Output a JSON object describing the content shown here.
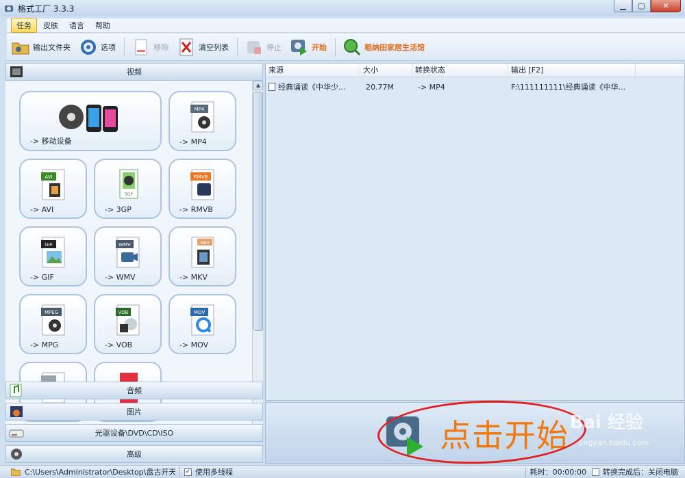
{
  "window": {
    "title": "格式工厂 3.3.3"
  },
  "menu": [
    "任务",
    "皮肤",
    "语言",
    "帮助"
  ],
  "toolbar": {
    "output_folder": "输出文件夹",
    "options": "选项",
    "remove": "移除",
    "clear_list": "清空列表",
    "stop": "停止",
    "start": "开始",
    "promo": "稻纳田家居生活馆"
  },
  "categories": {
    "video": "视频",
    "audio": "音频",
    "image": "图片",
    "disc": "光驱设备\\DVD\\CD\\ISO",
    "advanced": "高级"
  },
  "formats": [
    {
      "label": "-> 移动设备",
      "badge": ""
    },
    {
      "label": "-> MP4",
      "badge": "MP4"
    },
    {
      "label": "-> AVI",
      "badge": "AVI"
    },
    {
      "label": "-> 3GP",
      "badge": "3GP"
    },
    {
      "label": "-> RMVB",
      "badge": "RMVB"
    },
    {
      "label": "-> GIF",
      "badge": "GIF"
    },
    {
      "label": "-> WMV",
      "badge": "WMV"
    },
    {
      "label": "-> MKV",
      "badge": "MKV"
    },
    {
      "label": "-> MPG",
      "badge": "MPEG"
    },
    {
      "label": "-> VOB",
      "badge": "VOB"
    },
    {
      "label": "-> MOV",
      "badge": "MOV"
    }
  ],
  "table": {
    "columns": [
      "来源",
      "大小",
      "转换状态",
      "输出 [F2]"
    ],
    "rows": [
      {
        "source": "经典诵读《中华少...",
        "size": "20.77M",
        "status": "-> MP4",
        "output": "F:\\111111111\\经典诵读《中华..."
      }
    ]
  },
  "start_area": {
    "annotation": "点击开始",
    "watermark": "Bai 经验",
    "watermark_url": "jingyan.baidu.com"
  },
  "statusbar": {
    "path": "C:\\Users\\Administrator\\Desktop\\盘古开天地",
    "multithread": "使用多线程",
    "multithread_checked": "✓",
    "elapsed": "耗时：00:00:00",
    "shutdown": "转换完成后：关闭电脑"
  }
}
